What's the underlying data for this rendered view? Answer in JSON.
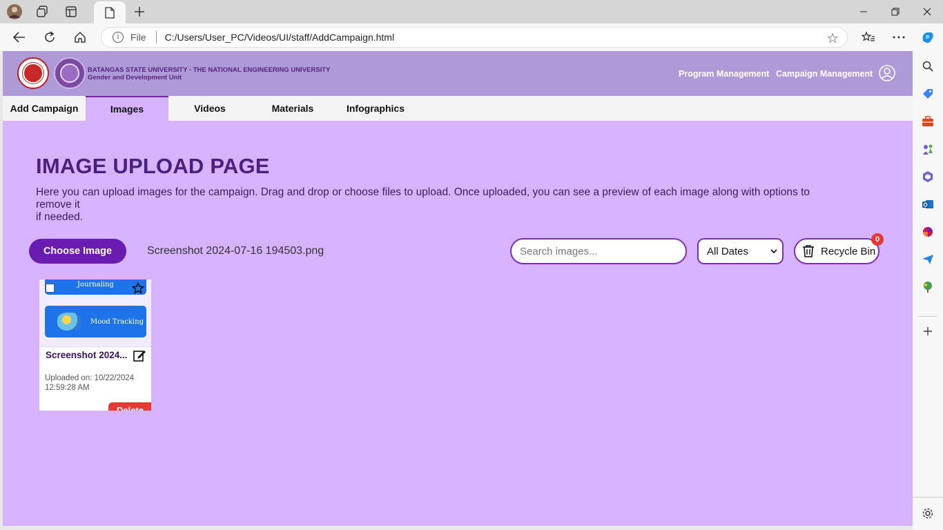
{
  "browser": {
    "address": "C:/Users/User_PC/Videos/UI/staff/AddCampaign.html",
    "scheme_label": "File"
  },
  "header": {
    "university": "BATANGAS STATE UNIVERSITY - THE NATIONAL ENGINEERING UNIVERSITY",
    "unit": "Gender and Development Unit",
    "nav": [
      "Program Management",
      "Campaign Management"
    ]
  },
  "subtabs": [
    {
      "label": "Add Campaign",
      "active": false
    },
    {
      "label": "Images",
      "active": true
    },
    {
      "label": "Videos",
      "active": false
    },
    {
      "label": "Materials",
      "active": false
    },
    {
      "label": "Infographics",
      "active": false
    }
  ],
  "main": {
    "title": "IMAGE UPLOAD PAGE",
    "description_line1": "Here you can upload images for the campaign. Drag and drop or choose files to upload. Once uploaded, you can see a preview of each image along with options to",
    "description_line2": "remove it",
    "description_line3": "if needed.",
    "choose_label": "Choose Image",
    "selected_file": "Screenshot 2024-07-16 194503.png",
    "search_placeholder": "Search images...",
    "date_filter": "All Dates",
    "recycle_label": "Recycle Bin",
    "recycle_count": "0"
  },
  "cards": [
    {
      "title": "Screenshot 2024...",
      "uploaded": "Uploaded on: 10/22/2024 12:59:28 AM",
      "delete_label": "Delete",
      "thumb_tile_top": "Journaling",
      "thumb_tile_bottom": "Mood Tracking"
    }
  ],
  "colors": {
    "page_bg": "#d6b3fc",
    "header_bg": "#ad9ad7",
    "accent": "#6a1bb0",
    "delete": "#e53935"
  }
}
